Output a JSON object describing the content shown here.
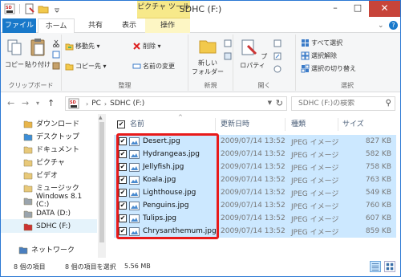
{
  "window": {
    "title": "SDHC (F:)",
    "context_tab_group": "ピクチャ ツール",
    "controls": {
      "minimize": "–",
      "maximize": "□",
      "close": "✕"
    }
  },
  "ribbon": {
    "tabs": {
      "file": "ファイル",
      "home": "ホーム",
      "share": "共有",
      "view": "表示",
      "manage": "操作"
    },
    "groups": {
      "clipboard": {
        "label": "クリップボード",
        "copy": "コピー",
        "paste": "貼り付け"
      },
      "organize": {
        "label": "整理",
        "move_to": "移動先 ▾",
        "copy_to": "コピー先 ▾",
        "delete": "削除 ▾",
        "rename": "名前の変更"
      },
      "new": {
        "label": "新規",
        "new_folder_line1": "新しい",
        "new_folder_line2": "フォルダー"
      },
      "open": {
        "label": "開く",
        "properties": "プロパティ"
      },
      "select": {
        "label": "選択",
        "select_all": "すべて選択",
        "select_none": "選択解除",
        "invert": "選択の切り替え"
      }
    }
  },
  "address": {
    "back": "←",
    "forward": "→",
    "recent": "▾",
    "up": "↑",
    "crumbs": [
      "PC",
      "SDHC (F:)"
    ],
    "crumb_sep": "›",
    "search_placeholder": "SDHC (F:)の検索"
  },
  "nav": {
    "items": [
      {
        "label": "ダウンロード",
        "icon": "download-folder-icon",
        "color": "#e8b54a"
      },
      {
        "label": "デスクトップ",
        "icon": "desktop-folder-icon",
        "color": "#3d8ed8"
      },
      {
        "label": "ドキュメント",
        "icon": "documents-folder-icon",
        "color": "#e8c97a"
      },
      {
        "label": "ピクチャ",
        "icon": "pictures-folder-icon",
        "color": "#e8c97a"
      },
      {
        "label": "ビデオ",
        "icon": "videos-folder-icon",
        "color": "#e8c97a"
      },
      {
        "label": "ミュージック",
        "icon": "music-folder-icon",
        "color": "#e8c97a"
      },
      {
        "label": "Windows 8.1 (C:)",
        "icon": "windows-drive-icon",
        "color": "#9aa4ad"
      },
      {
        "label": "DATA (D:)",
        "icon": "drive-icon",
        "color": "#9aa4ad"
      },
      {
        "label": "SDHC (F:)",
        "icon": "sd-card-icon",
        "color": "#c33"
      },
      {
        "label": "ネットワーク",
        "icon": "network-icon",
        "color": "#4a7fbf"
      }
    ]
  },
  "list": {
    "columns": {
      "name": "名前",
      "modified": "更新日時",
      "type": "種類",
      "size": "サイズ"
    },
    "files": [
      {
        "name": "Desert.jpg",
        "modified": "2009/07/14 13:52",
        "type": "JPEG イメージ",
        "size": "827 KB"
      },
      {
        "name": "Hydrangeas.jpg",
        "modified": "2009/07/14 13:52",
        "type": "JPEG イメージ",
        "size": "582 KB"
      },
      {
        "name": "Jellyfish.jpg",
        "modified": "2009/07/14 13:52",
        "type": "JPEG イメージ",
        "size": "758 KB"
      },
      {
        "name": "Koala.jpg",
        "modified": "2009/07/14 13:52",
        "type": "JPEG イメージ",
        "size": "763 KB"
      },
      {
        "name": "Lighthouse.jpg",
        "modified": "2009/07/14 13:52",
        "type": "JPEG イメージ",
        "size": "549 KB"
      },
      {
        "name": "Penguins.jpg",
        "modified": "2009/07/14 13:52",
        "type": "JPEG イメージ",
        "size": "760 KB"
      },
      {
        "name": "Tulips.jpg",
        "modified": "2009/07/14 13:52",
        "type": "JPEG イメージ",
        "size": "607 KB"
      },
      {
        "name": "Chrysanthemum.jpg",
        "modified": "2009/07/14 13:52",
        "type": "JPEG イメージ",
        "size": "859 KB"
      }
    ],
    "check_mark": "✔"
  },
  "status": {
    "item_count": "8 個の項目",
    "selected": "8 個の項目を選択",
    "selected_size": "5.56 MB"
  },
  "colors": {
    "accent": "#1979ca",
    "selection": "#cce8ff",
    "highlight_border": "#e81a1a",
    "context_tab": "#f7e98a"
  }
}
